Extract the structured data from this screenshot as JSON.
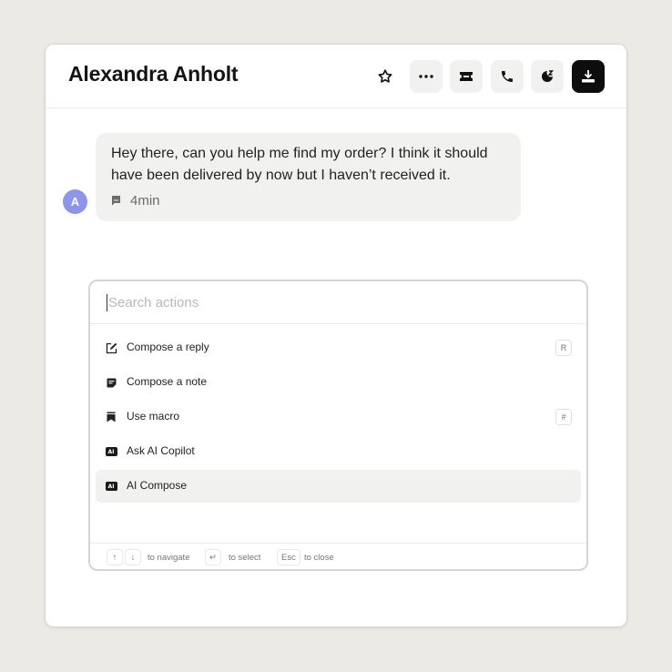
{
  "header": {
    "title": "Alexandra Anholt",
    "buttons": [
      {
        "name": "star",
        "icon": "star-icon"
      },
      {
        "name": "more",
        "icon": "more-horizontal-icon"
      },
      {
        "name": "ticket",
        "icon": "ticket-icon"
      },
      {
        "name": "phone",
        "icon": "phone-icon"
      },
      {
        "name": "snooze",
        "icon": "snooze-icon"
      },
      {
        "name": "close-conversation",
        "icon": "inbox-download-icon"
      }
    ]
  },
  "conversation": {
    "avatar_initial": "A",
    "avatar_color": "#8c95ea",
    "message": "Hey there, can you help me find my order? I think it should have been delivered by now but I haven’t received it.",
    "time": "4min",
    "channel_icon": "chat-icon"
  },
  "command_palette": {
    "search_placeholder": "Search actions",
    "search_value": "",
    "items": [
      {
        "label": "Compose a reply",
        "icon": "edit-icon",
        "shortcut": "R",
        "selected": false
      },
      {
        "label": "Compose a note",
        "icon": "note-icon",
        "shortcut": "",
        "selected": false
      },
      {
        "label": "Use macro",
        "icon": "bookmark-icon",
        "shortcut": "#",
        "selected": false
      },
      {
        "label": "Ask AI Copilot",
        "icon": "ai-icon",
        "shortcut": "",
        "selected": false
      },
      {
        "label": "AI Compose",
        "icon": "ai-icon",
        "shortcut": "",
        "selected": true
      }
    ],
    "ai_badge_text": "AI",
    "footer": {
      "navigate_keys": [
        "↑",
        "↓"
      ],
      "navigate_label": "to navigate",
      "select_key": "↵",
      "select_label": "to select",
      "close_key": "Esc",
      "close_label": "to close"
    }
  },
  "colors": {
    "background": "#ebeae5",
    "panel": "#ffffff",
    "bubble": "#f1f1f0",
    "accent_dark": "#0d0d0d"
  }
}
